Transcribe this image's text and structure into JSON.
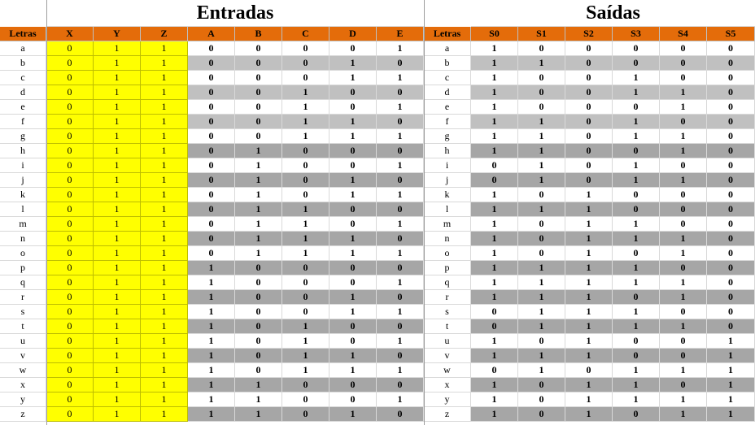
{
  "titles": {
    "entradas": "Entradas",
    "saidas": "Saídas"
  },
  "headers_left": [
    "Letras",
    "X",
    "Y",
    "Z",
    "A",
    "B",
    "C",
    "D",
    "E"
  ],
  "headers_right": [
    "Letras",
    "S0",
    "S1",
    "S2",
    "S3",
    "S4",
    "S5"
  ],
  "colors": {
    "header": "#e46c0a",
    "xyz": "#ffff00",
    "light_gray": "#c0c0c0",
    "dark_gray": "#a6a6a6",
    "white": "#ffffff"
  },
  "rows": [
    {
      "letter": "a",
      "xyz": [
        "0",
        "1",
        "1"
      ],
      "inputs": [
        "0",
        "0",
        "0",
        "0",
        "1"
      ],
      "outputs": [
        "1",
        "0",
        "0",
        "0",
        "0",
        "0"
      ],
      "shade_in": "w",
      "shade_out": "w"
    },
    {
      "letter": "b",
      "xyz": [
        "0",
        "1",
        "1"
      ],
      "inputs": [
        "0",
        "0",
        "0",
        "1",
        "0"
      ],
      "outputs": [
        "1",
        "1",
        "0",
        "0",
        "0",
        "0"
      ],
      "shade_in": "l",
      "shade_out": "l"
    },
    {
      "letter": "c",
      "xyz": [
        "0",
        "1",
        "1"
      ],
      "inputs": [
        "0",
        "0",
        "0",
        "1",
        "1"
      ],
      "outputs": [
        "1",
        "0",
        "0",
        "1",
        "0",
        "0"
      ],
      "shade_in": "w",
      "shade_out": "w"
    },
    {
      "letter": "d",
      "xyz": [
        "0",
        "1",
        "1"
      ],
      "inputs": [
        "0",
        "0",
        "1",
        "0",
        "0"
      ],
      "outputs": [
        "1",
        "0",
        "0",
        "1",
        "1",
        "0"
      ],
      "shade_in": "l",
      "shade_out": "l"
    },
    {
      "letter": "e",
      "xyz": [
        "0",
        "1",
        "1"
      ],
      "inputs": [
        "0",
        "0",
        "1",
        "0",
        "1"
      ],
      "outputs": [
        "1",
        "0",
        "0",
        "0",
        "1",
        "0"
      ],
      "shade_in": "w",
      "shade_out": "w"
    },
    {
      "letter": "f",
      "xyz": [
        "0",
        "1",
        "1"
      ],
      "inputs": [
        "0",
        "0",
        "1",
        "1",
        "0"
      ],
      "outputs": [
        "1",
        "1",
        "0",
        "1",
        "0",
        "0"
      ],
      "shade_in": "l",
      "shade_out": "l"
    },
    {
      "letter": "g",
      "xyz": [
        "0",
        "1",
        "1"
      ],
      "inputs": [
        "0",
        "0",
        "1",
        "1",
        "1"
      ],
      "outputs": [
        "1",
        "1",
        "0",
        "1",
        "1",
        "0"
      ],
      "shade_in": "w",
      "shade_out": "w"
    },
    {
      "letter": "h",
      "xyz": [
        "0",
        "1",
        "1"
      ],
      "inputs": [
        "0",
        "1",
        "0",
        "0",
        "0"
      ],
      "outputs": [
        "1",
        "1",
        "0",
        "0",
        "1",
        "0"
      ],
      "shade_in": "d",
      "shade_out": "d"
    },
    {
      "letter": "i",
      "xyz": [
        "0",
        "1",
        "1"
      ],
      "inputs": [
        "0",
        "1",
        "0",
        "0",
        "1"
      ],
      "outputs": [
        "0",
        "1",
        "0",
        "1",
        "0",
        "0"
      ],
      "shade_in": "w",
      "shade_out": "w"
    },
    {
      "letter": "j",
      "xyz": [
        "0",
        "1",
        "1"
      ],
      "inputs": [
        "0",
        "1",
        "0",
        "1",
        "0"
      ],
      "outputs": [
        "0",
        "1",
        "0",
        "1",
        "1",
        "0"
      ],
      "shade_in": "d",
      "shade_out": "d"
    },
    {
      "letter": "k",
      "xyz": [
        "0",
        "1",
        "1"
      ],
      "inputs": [
        "0",
        "1",
        "0",
        "1",
        "1"
      ],
      "outputs": [
        "1",
        "0",
        "1",
        "0",
        "0",
        "0"
      ],
      "shade_in": "w",
      "shade_out": "w"
    },
    {
      "letter": "l",
      "xyz": [
        "0",
        "1",
        "1"
      ],
      "inputs": [
        "0",
        "1",
        "1",
        "0",
        "0"
      ],
      "outputs": [
        "1",
        "1",
        "1",
        "0",
        "0",
        "0"
      ],
      "shade_in": "d",
      "shade_out": "d"
    },
    {
      "letter": "m",
      "xyz": [
        "0",
        "1",
        "1"
      ],
      "inputs": [
        "0",
        "1",
        "1",
        "0",
        "1"
      ],
      "outputs": [
        "1",
        "0",
        "1",
        "1",
        "0",
        "0"
      ],
      "shade_in": "w",
      "shade_out": "w"
    },
    {
      "letter": "n",
      "xyz": [
        "0",
        "1",
        "1"
      ],
      "inputs": [
        "0",
        "1",
        "1",
        "1",
        "0"
      ],
      "outputs": [
        "1",
        "0",
        "1",
        "1",
        "1",
        "0"
      ],
      "shade_in": "d",
      "shade_out": "d"
    },
    {
      "letter": "o",
      "xyz": [
        "0",
        "1",
        "1"
      ],
      "inputs": [
        "0",
        "1",
        "1",
        "1",
        "1"
      ],
      "outputs": [
        "1",
        "0",
        "1",
        "0",
        "1",
        "0"
      ],
      "shade_in": "w",
      "shade_out": "w"
    },
    {
      "letter": "p",
      "xyz": [
        "0",
        "1",
        "1"
      ],
      "inputs": [
        "1",
        "0",
        "0",
        "0",
        "0"
      ],
      "outputs": [
        "1",
        "1",
        "1",
        "1",
        "0",
        "0"
      ],
      "shade_in": "d",
      "shade_out": "d"
    },
    {
      "letter": "q",
      "xyz": [
        "0",
        "1",
        "1"
      ],
      "inputs": [
        "1",
        "0",
        "0",
        "0",
        "1"
      ],
      "outputs": [
        "1",
        "1",
        "1",
        "1",
        "1",
        "0"
      ],
      "shade_in": "w",
      "shade_out": "w"
    },
    {
      "letter": "r",
      "xyz": [
        "0",
        "1",
        "1"
      ],
      "inputs": [
        "1",
        "0",
        "0",
        "1",
        "0"
      ],
      "outputs": [
        "1",
        "1",
        "1",
        "0",
        "1",
        "0"
      ],
      "shade_in": "d",
      "shade_out": "d"
    },
    {
      "letter": "s",
      "xyz": [
        "0",
        "1",
        "1"
      ],
      "inputs": [
        "1",
        "0",
        "0",
        "1",
        "1"
      ],
      "outputs": [
        "0",
        "1",
        "1",
        "1",
        "0",
        "0"
      ],
      "shade_in": "w",
      "shade_out": "w"
    },
    {
      "letter": "t",
      "xyz": [
        "0",
        "1",
        "1"
      ],
      "inputs": [
        "1",
        "0",
        "1",
        "0",
        "0"
      ],
      "outputs": [
        "0",
        "1",
        "1",
        "1",
        "1",
        "0"
      ],
      "shade_in": "d",
      "shade_out": "d"
    },
    {
      "letter": "u",
      "xyz": [
        "0",
        "1",
        "1"
      ],
      "inputs": [
        "1",
        "0",
        "1",
        "0",
        "1"
      ],
      "outputs": [
        "1",
        "0",
        "1",
        "0",
        "0",
        "1"
      ],
      "shade_in": "w",
      "shade_out": "w"
    },
    {
      "letter": "v",
      "xyz": [
        "0",
        "1",
        "1"
      ],
      "inputs": [
        "1",
        "0",
        "1",
        "1",
        "0"
      ],
      "outputs": [
        "1",
        "1",
        "1",
        "0",
        "0",
        "1"
      ],
      "shade_in": "d",
      "shade_out": "d"
    },
    {
      "letter": "w",
      "xyz": [
        "0",
        "1",
        "1"
      ],
      "inputs": [
        "1",
        "0",
        "1",
        "1",
        "1"
      ],
      "outputs": [
        "0",
        "1",
        "0",
        "1",
        "1",
        "1"
      ],
      "shade_in": "w",
      "shade_out": "w"
    },
    {
      "letter": "x",
      "xyz": [
        "0",
        "1",
        "1"
      ],
      "inputs": [
        "1",
        "1",
        "0",
        "0",
        "0"
      ],
      "outputs": [
        "1",
        "0",
        "1",
        "1",
        "0",
        "1"
      ],
      "shade_in": "d",
      "shade_out": "d"
    },
    {
      "letter": "y",
      "xyz": [
        "0",
        "1",
        "1"
      ],
      "inputs": [
        "1",
        "1",
        "0",
        "0",
        "1"
      ],
      "outputs": [
        "1",
        "0",
        "1",
        "1",
        "1",
        "1"
      ],
      "shade_in": "w",
      "shade_out": "w"
    },
    {
      "letter": "z",
      "xyz": [
        "0",
        "1",
        "1"
      ],
      "inputs": [
        "1",
        "1",
        "0",
        "1",
        "0"
      ],
      "outputs": [
        "1",
        "0",
        "1",
        "0",
        "1",
        "1"
      ],
      "shade_in": "d",
      "shade_out": "d"
    }
  ]
}
